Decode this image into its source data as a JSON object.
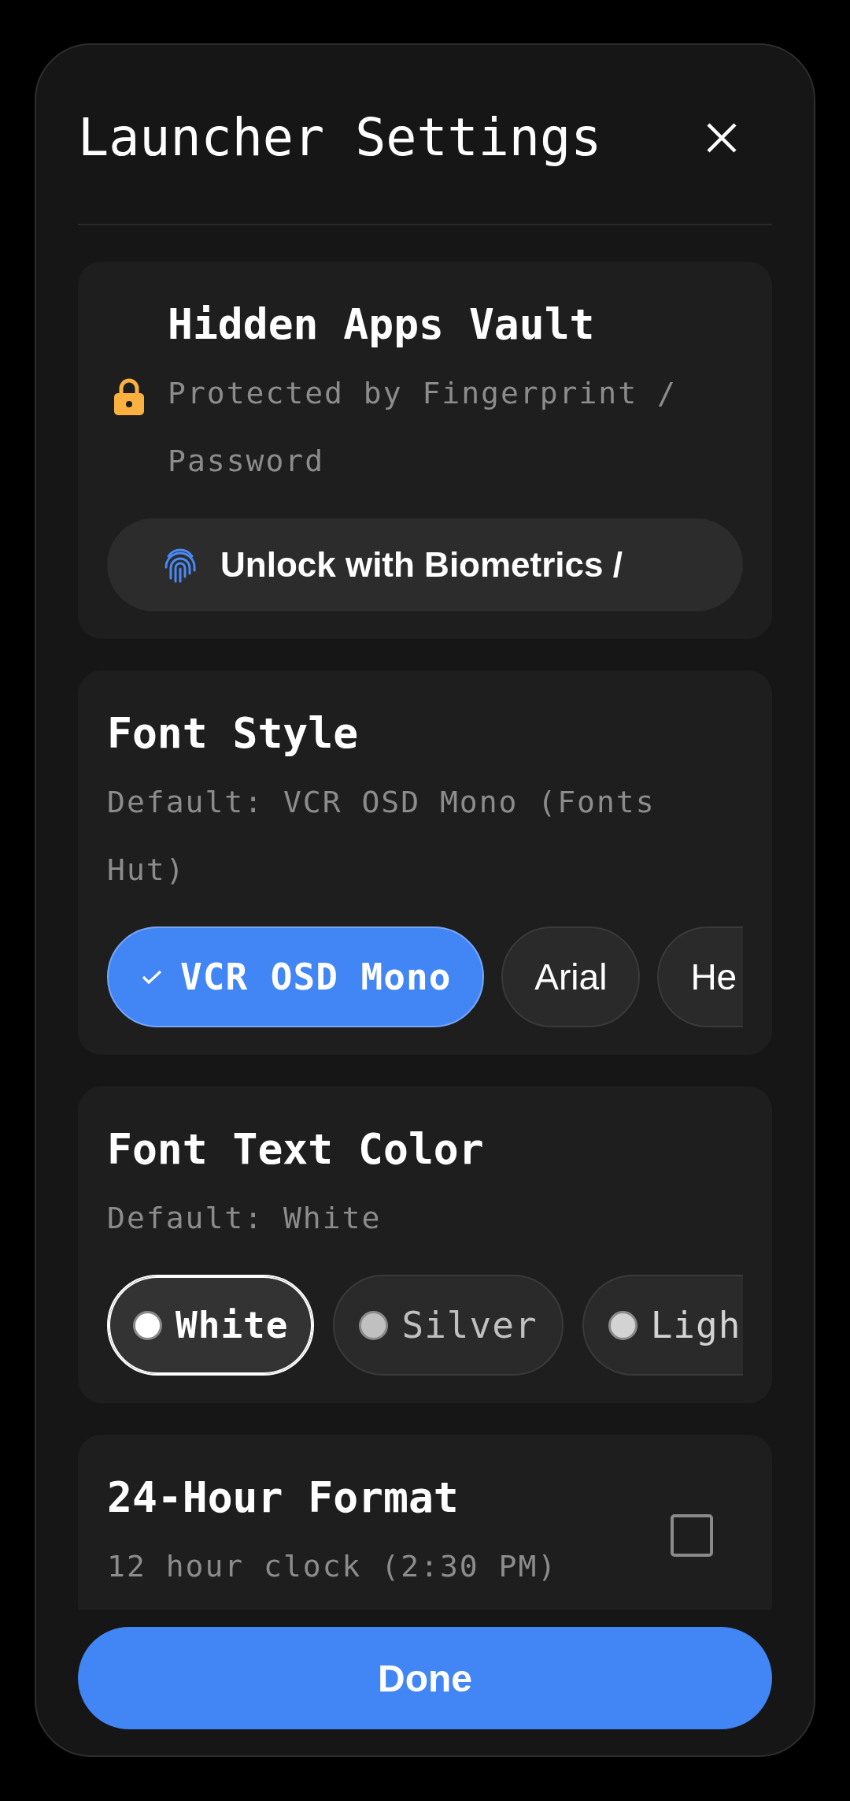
{
  "dialog": {
    "title": "Launcher Settings"
  },
  "vault": {
    "title": "Hidden Apps Vault",
    "subtitle": "Protected by Fingerprint / Password",
    "button": "Unlock with Biometrics /"
  },
  "font_style": {
    "title": "Font Style",
    "subtitle": "Default: VCR OSD Mono (Fonts Hut)",
    "options": [
      {
        "label": "VCR OSD Mono",
        "kind": "mono",
        "selected": true
      },
      {
        "label": "Arial",
        "kind": "sans",
        "selected": false
      },
      {
        "label": "He",
        "kind": "sans",
        "selected": false
      }
    ]
  },
  "font_color": {
    "title": "Font Text Color",
    "subtitle": "Default: White",
    "options": [
      {
        "label": "White",
        "color": "#ffffff",
        "selected": true
      },
      {
        "label": "Silver",
        "color": "#c0c0c0",
        "selected": false
      },
      {
        "label": "Ligh",
        "color": "#d3d3d3",
        "selected": false
      }
    ]
  },
  "clock_format": {
    "title": "24-Hour Format",
    "subtitle": "12 hour clock (2:30 PM)",
    "checked": false
  },
  "done_button": "Done"
}
